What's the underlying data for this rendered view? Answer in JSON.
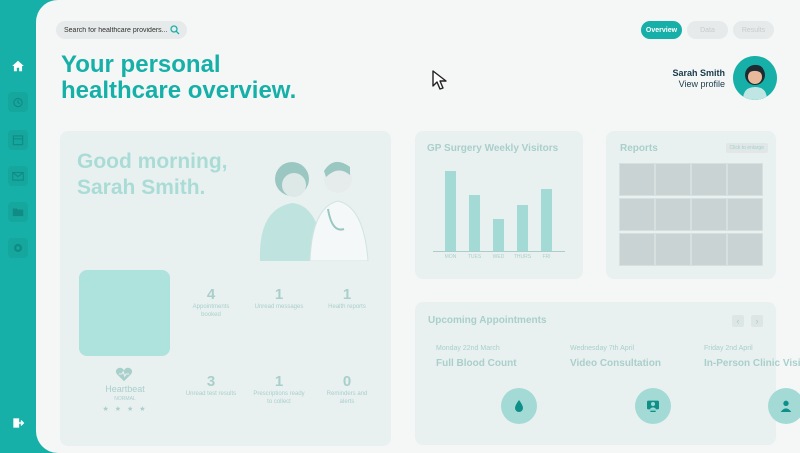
{
  "search": {
    "placeholder": "Search for healthcare providers..."
  },
  "tabs": [
    {
      "label": "Overview"
    },
    {
      "label": "Data"
    },
    {
      "label": "Results"
    }
  ],
  "header": {
    "title_line1": "Your personal",
    "title_line2": "healthcare overview."
  },
  "profile": {
    "name": "Sarah Smith",
    "link": "View profile"
  },
  "greeting": {
    "line1": "Good morning,",
    "line2": "Sarah Smith."
  },
  "stats": [
    {
      "value": "4",
      "label": "Appointments booked"
    },
    {
      "value": "1",
      "label": "Unread messages"
    },
    {
      "value": "1",
      "label": "Health reports"
    },
    {
      "value": "3",
      "label": "Unread test results"
    },
    {
      "value": "1",
      "label": "Prescriptions ready to collect"
    },
    {
      "value": "0",
      "label": "Reminders and alerts"
    }
  ],
  "heartbeat": {
    "label": "Heartbeat",
    "status": "NORMAL",
    "stars": "★ ★ ★ ★"
  },
  "visitors_card": {
    "title": "GP Surgery Weekly Visitors"
  },
  "chart_data": {
    "type": "bar",
    "title": "GP Surgery Weekly Visitors",
    "categories": [
      "MON",
      "TUES",
      "WED",
      "THURS",
      "FRI"
    ],
    "values": [
      100,
      70,
      40,
      57,
      78
    ],
    "ylim": [
      0,
      100
    ],
    "grid": false,
    "color": "#17b0a8"
  },
  "reports_card": {
    "title": "Reports",
    "enlarge": "Click to enlarge"
  },
  "appointments_card": {
    "title": "Upcoming Appointments",
    "items": [
      {
        "date": "Monday 22nd March",
        "name": "Full Blood Count",
        "icon": "blood-drop-icon"
      },
      {
        "date": "Wednesday 7th April",
        "name": "Video Consultation",
        "icon": "video-doctor-icon"
      },
      {
        "date": "Friday 2nd April",
        "name": "In-Person Clinic Visit",
        "icon": "person-icon"
      }
    ]
  },
  "colors": {
    "accent": "#17b0a8",
    "dark_text": "#1a3a4a",
    "background": "#f5f7f7"
  }
}
